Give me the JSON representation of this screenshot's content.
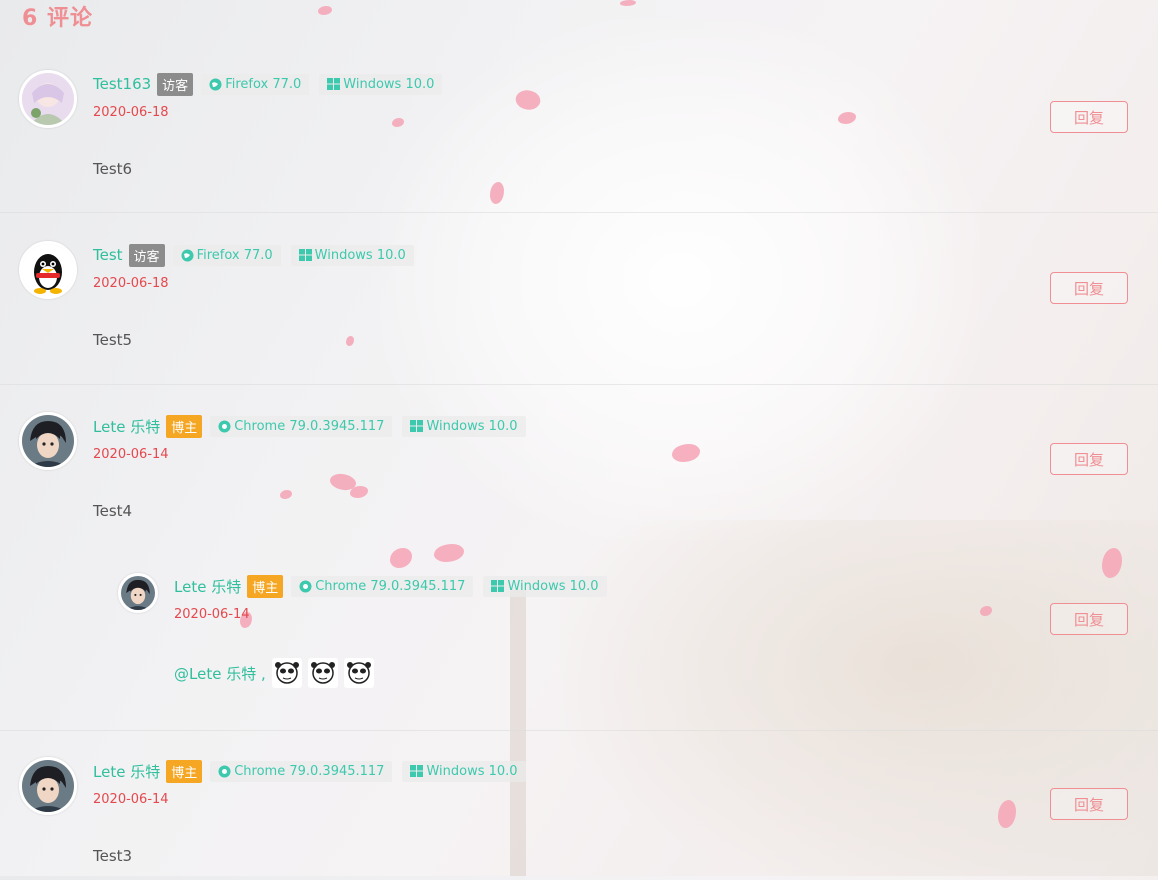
{
  "comments_header": {
    "count_label": "6 评论"
  },
  "browser_icon": "globe-icon",
  "os_icon": "windows-icon",
  "reply_label": "回复",
  "comments": [
    {
      "author": "Test163",
      "badge": "访客",
      "browser": "Firefox 77.0",
      "os": "Windows 10.0",
      "date": "2020-06-18",
      "text": "Test6",
      "avatar": "anime-girl-avatar"
    },
    {
      "author": "Test",
      "badge": "访客",
      "browser": "Firefox 77.0",
      "os": "Windows 10.0",
      "date": "2020-06-18",
      "text": "Test5",
      "avatar": "qq-penguin-avatar"
    },
    {
      "author": "Lete 乐特",
      "badge": "博主",
      "browser": "Chrome 79.0.3945.117",
      "os": "Windows 10.0",
      "date": "2020-06-14",
      "text": "Test4",
      "avatar": "anime-boy-avatar"
    },
    {
      "author": "Lete 乐特",
      "badge": "博主",
      "browser": "Chrome 79.0.3945.117",
      "os": "Windows 10.0",
      "date": "2020-06-14",
      "mention": "@Lete 乐特 ,",
      "emojis": [
        "panda-emoji",
        "panda-emoji",
        "panda-emoji"
      ],
      "avatar": "anime-boy-avatar"
    },
    {
      "author": "Lete 乐特",
      "badge": "博主",
      "browser": "Chrome 79.0.3945.117",
      "os": "Windows 10.0",
      "date": "2020-06-14",
      "text": "Test3",
      "avatar": "anime-boy-avatar"
    }
  ],
  "colors": {
    "author": "#2fbf9d",
    "date": "#e5484d",
    "accent": "#ef8f93",
    "guest_badge": "#8c8c8c",
    "owner_badge": "#f5a623"
  }
}
